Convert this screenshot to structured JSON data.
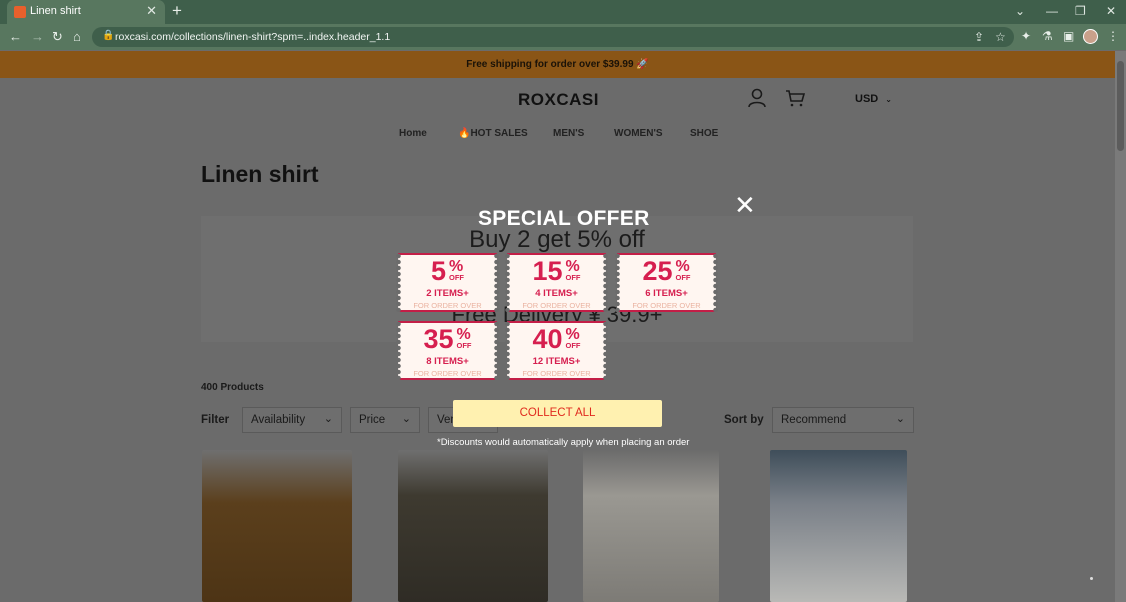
{
  "browser": {
    "tab_title": "Linen shirt",
    "url": "roxcasi.com/collections/linen-shirt?spm=..index.header_1.1",
    "tab_close_glyph": "✕",
    "new_tab_glyph": "+"
  },
  "store": {
    "announcement": "Free shipping for order over $39.99 🚀",
    "logo": "ROXCASI",
    "currency": "USD",
    "nav": [
      {
        "label": "Home"
      },
      {
        "label": "🔥HOT SALES"
      },
      {
        "label": "MEN'S"
      },
      {
        "label": "WOMEN'S"
      },
      {
        "label": "SHOE"
      }
    ]
  },
  "collection": {
    "title": "Linen shirt",
    "banner_line1": "Buy 2 get 5% off",
    "banner_line2": "Free Delivery ¥ 39.9+",
    "product_count": "400 Products",
    "filter_label": "Filter",
    "filters": [
      "Availability",
      "Price",
      "Ven"
    ],
    "sort_label": "Sort by",
    "sort_value": "Recommend"
  },
  "popup": {
    "title": "SPECIAL OFFER",
    "close_glyph": "✕",
    "coupons": [
      {
        "value": "5",
        "symbol": "%",
        "off": "OFF",
        "items": "2 ITEMS+",
        "footnote": "FOR ORDER OVER"
      },
      {
        "value": "15",
        "symbol": "%",
        "off": "OFF",
        "items": "4 ITEMS+",
        "footnote": "FOR ORDER OVER"
      },
      {
        "value": "25",
        "symbol": "%",
        "off": "OFF",
        "items": "6 ITEMS+",
        "footnote": "FOR ORDER OVER"
      },
      {
        "value": "35",
        "symbol": "%",
        "off": "OFF",
        "items": "8 ITEMS+",
        "footnote": "FOR ORDER OVER"
      },
      {
        "value": "40",
        "symbol": "%",
        "off": "OFF",
        "items": "12 ITEMS+",
        "footnote": "FOR ORDER OVER"
      }
    ],
    "collect_label": "COLLECT ALL",
    "note": "*Discounts would automatically apply when placing an order"
  },
  "colors": {
    "announcement_bg": "#8a5516",
    "coupon_red": "#d61f4f",
    "collect_bg": "#fff1b0",
    "collect_text": "#e02a1e"
  }
}
